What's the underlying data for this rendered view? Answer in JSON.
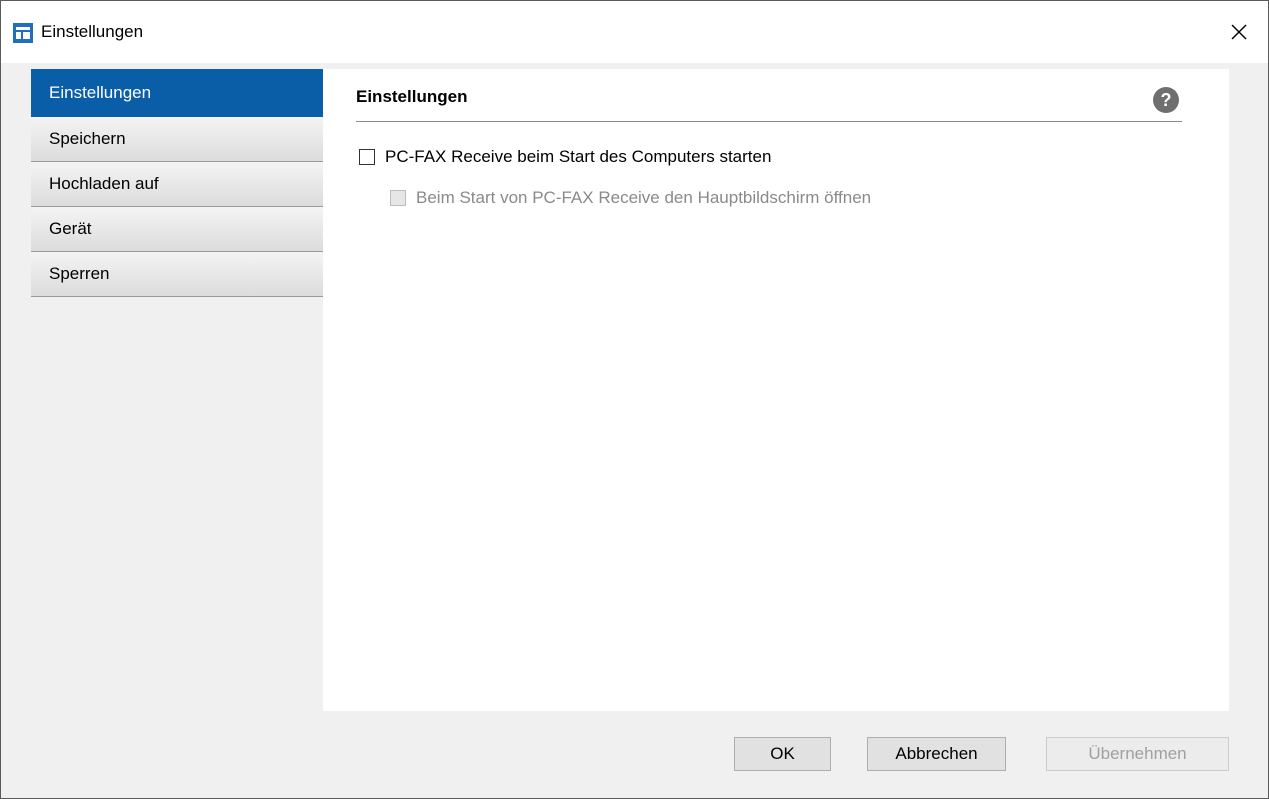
{
  "window": {
    "title": "Einstellungen"
  },
  "sidebar": {
    "items": [
      {
        "label": "Einstellungen"
      },
      {
        "label": "Speichern"
      },
      {
        "label": "Hochladen auf"
      },
      {
        "label": "Gerät"
      },
      {
        "label": "Sperren"
      }
    ],
    "selected_index": 0
  },
  "main": {
    "section_title": "Einstellungen",
    "options": [
      {
        "label": "PC-FAX Receive beim Start des Computers starten",
        "checked": false,
        "enabled": true
      },
      {
        "label": "Beim Start von PC-FAX Receive den Hauptbildschirm öffnen",
        "checked": false,
        "enabled": false
      }
    ]
  },
  "buttons": {
    "ok": "OK",
    "cancel": "Abbrechen",
    "apply": "Übernehmen"
  },
  "icons": {
    "app": "app-settings-icon",
    "close": "close-icon",
    "help": "help-icon"
  },
  "colors": {
    "accent": "#0a5ea8",
    "help_icon": "#6f6f6f"
  }
}
